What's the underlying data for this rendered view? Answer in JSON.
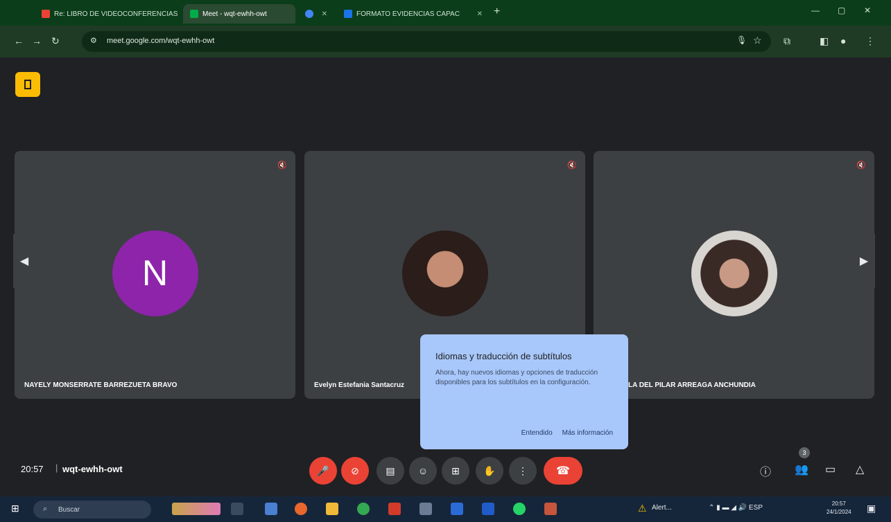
{
  "browser": {
    "tabs": [
      {
        "label": "Re: LIBRO DE VIDEOCONFERENCIAS",
        "active": false,
        "favicon_color": "#ea4335"
      },
      {
        "label": "Meet - wqt-ewhh-owt",
        "active": true,
        "favicon_color": "#00ac47"
      },
      {
        "label": "",
        "active": false,
        "favicon_color": "#4285f4"
      },
      {
        "label": "FORMATO EVIDENCIAS CAPAC",
        "active": false,
        "favicon_color": "#1a73e8"
      }
    ],
    "url": "meet.google.com/wqt-ewhh-owt"
  },
  "meet": {
    "participants": [
      {
        "name": "NAYELY MONSERRATE BARREZUETA BRAVO",
        "avatar_letter": "N",
        "avatar_color": "#8e24aa"
      },
      {
        "name": "Evelyn Estefania Santacruz",
        "avatar_letter": ""
      },
      {
        "name": "LA DEL PILAR ARREAGA ANCHUNDIA",
        "avatar_letter": ""
      }
    ],
    "popup": {
      "title": "Idiomas y traducción de subtítulos",
      "body": "Ahora, hay nuevos idiomas y opciones de traducción disponibles para los subtítulos en la configuración.",
      "btn_ok": "Entendido",
      "btn_more": "Más información"
    },
    "bottom": {
      "time": "20:57",
      "meeting_code": "wqt-ewhh-owt",
      "people_count": "3"
    },
    "colors": {
      "accent_red": "#ea4335",
      "popup_bg": "#a8c7fa",
      "tile_bg": "#3c4043"
    }
  },
  "taskbar": {
    "search_placeholder": "Buscar",
    "alert_label": "Alert...",
    "time": "20:57",
    "date": "24/1/2024"
  }
}
